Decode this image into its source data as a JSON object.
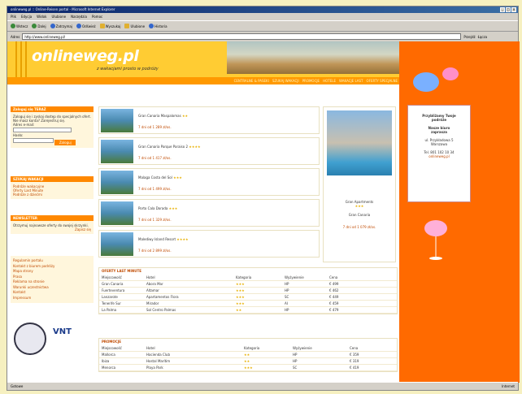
{
  "browser": {
    "title": "onlineweg.pl :: Online-Reisen portal - Microsoft Internet Explorer",
    "menu": [
      "Plik",
      "Edycja",
      "Widok",
      "Ulubione",
      "Narzędzia",
      "Pomoc"
    ],
    "toolbar": [
      "Wstecz",
      "Dalej",
      "Zatrzymaj",
      "Odśwież",
      "Wyszukaj",
      "Ulubione",
      "Historia"
    ],
    "address_label": "Adres",
    "address": "http://www.onlineweg.pl/",
    "go_label": "Przejdź",
    "links_label": "Łącza",
    "status": "Gotowe",
    "zone": "Internet"
  },
  "site": {
    "logo_main": "onlineweg",
    "logo_tld": ".pl",
    "tagline": "z wakacjami prosto w podróży",
    "nav": [
      "OFERTY",
      "CENTRALNE & PASEKI",
      "SZUKAJ WAKACJI",
      "PROMOCJE",
      "HOTELE",
      "WAKACJE LAST",
      "OFERTY SPECJALNE"
    ]
  },
  "left": {
    "login": {
      "heading": "Zaloguj się TERAZ",
      "text": "Zaloguj się i zyskaj dostęp do specjalnych ofert. Nie masz konta? Zarejestruj się.",
      "email_label": "Adres e-mail:",
      "pass_label": "Hasło:",
      "button": "Zaloguj"
    },
    "search": {
      "heading": "SZUKAJ WAKACJI",
      "items": [
        "Podróże wakacyjne",
        "Oferty Last Minute",
        "Podróże z dziećmi"
      ]
    },
    "newsletter": {
      "heading": "NEWSLETTER",
      "text": "Otrzymuj najnowsze oferty do swojej skrzynki.",
      "link": "Zapisz się"
    },
    "links": [
      "Regulamin portalu",
      "Kontakt z biurem podróży",
      "Mapa strony",
      "Prasa",
      "Reklama na stronie",
      "Warunki uczestnictwa",
      "Kontakt",
      "Impressum"
    ]
  },
  "hotels": [
    {
      "name": "Gran Canaria Maspalomas",
      "stars": "★★",
      "price": "7 dni od 1 289 zł/os."
    },
    {
      "name": "Gran Canaria Parque Paraiso 2",
      "stars": "★★★★",
      "price": "7 dni od 1 417 zł/os."
    },
    {
      "name": "Malaga Costa del Sol",
      "stars": "★★★",
      "price": "7 dni od 1 499 zł/os."
    },
    {
      "name": "Porto Cala Dorada",
      "stars": "★★★",
      "price": "7 dni od 1 329 zł/os."
    },
    {
      "name": "Malediwy Island Resort",
      "stars": "★★★★",
      "price": "7 dni od 2 899 zł/os."
    }
  ],
  "featured": {
    "name": "Gran Apartments",
    "stars": "★★★",
    "loc": "Gran Canaria",
    "price": "7 dni od 1 079 zł/os."
  },
  "table1": {
    "heading": "OFERTY LAST MINUTE",
    "header": [
      "Miejscowość",
      "Hotel",
      "Kategoria",
      "Wyżywienie",
      "Cena"
    ],
    "rows": [
      [
        "Gran Canaria",
        "Abora Mar",
        "★★★",
        "HP",
        "€ 499"
      ],
      [
        "Fuerteventura",
        "Altamar",
        "★★★",
        "HP",
        "€ 462"
      ],
      [
        "Lanzarote",
        "Apartamentos Flora",
        "★★★",
        "SC",
        "€ 449"
      ],
      [
        "Tenerife Sur",
        "Mirador",
        "★★★",
        "AI",
        "€ 459"
      ],
      [
        "La Palma",
        "Sol Centro Palmas",
        "★★",
        "HP",
        "€ 479"
      ]
    ]
  },
  "table2": {
    "heading": "PROMOCJE",
    "header": [
      "Miejscowość",
      "Hotel",
      "Kategoria",
      "Wyżywienie",
      "Cena"
    ],
    "rows": [
      [
        "Mallorca",
        "Hacienda Club",
        "★★",
        "HP",
        "€ 359"
      ],
      [
        "Ibiza",
        "Hostal Marítim",
        "★★",
        "HP",
        "€ 319"
      ],
      [
        "Menorca",
        "Playa Park",
        "★★★",
        "SC",
        "€ 419"
      ]
    ]
  },
  "right": {
    "lines": [
      "Przybliżamy Twoje",
      "podróże",
      "",
      "Nasze biuro",
      "zaprasza",
      "",
      "ul. Przykładowa 5",
      "Warszawa",
      "",
      "Tel. 801 102 10 34"
    ],
    "brand": "onlineweg.pl"
  }
}
